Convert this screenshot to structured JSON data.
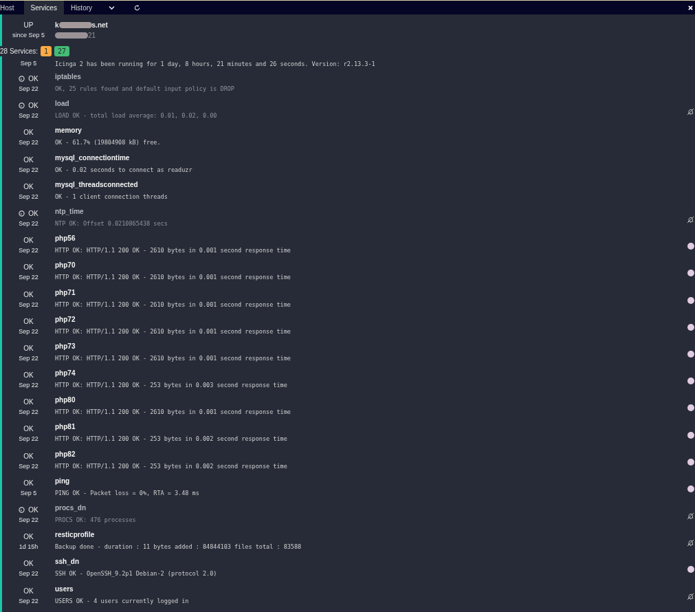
{
  "tabs": [
    {
      "label": "Host",
      "selected": false
    },
    {
      "label": "Services",
      "selected": true
    },
    {
      "label": "History",
      "selected": false
    }
  ],
  "host": {
    "state": "UP",
    "since": "since Sep 5",
    "name_start": "k",
    "name_end": "s.net",
    "address_end": "21"
  },
  "summary": {
    "label": "28 Services:",
    "badges": [
      {
        "count": "1",
        "color": "#ffaa44"
      },
      {
        "count": "27",
        "color": "#44bb77"
      }
    ]
  },
  "host_check": {
    "time": "Sep 5",
    "output": "Icinga 2 has been running for 1 day, 8 hours, 21 minutes and 26 seconds. Version: r2.13.3-1"
  },
  "services": [
    {
      "state": "OK",
      "time": "Sep 22",
      "name": "iptables",
      "output": "OK, 25 rules found and default input policy is DROP",
      "handled": true,
      "notifications_off": false,
      "dot": false
    },
    {
      "state": "OK",
      "time": "Sep 22",
      "name": "load",
      "output": "LOAD OK - total load average: 0.01, 0.02, 0.00",
      "handled": true,
      "notifications_off": true,
      "dot": false
    },
    {
      "state": "OK",
      "time": "Sep 22",
      "name": "memory",
      "output": "OK - 61.7% (19804908 kB) free.",
      "handled": false,
      "notifications_off": false,
      "dot": false
    },
    {
      "state": "OK",
      "time": "Sep 22",
      "name": "mysql_connectiontime",
      "output": "OK - 0.02 seconds to connect as readuzr",
      "handled": false,
      "notifications_off": false,
      "dot": false
    },
    {
      "state": "OK",
      "time": "Sep 22",
      "name": "mysql_threadsconnected",
      "output": "OK - 1 client connection threads",
      "handled": false,
      "notifications_off": false,
      "dot": false
    },
    {
      "state": "OK",
      "time": "Sep 22",
      "name": "ntp_time",
      "output": "NTP OK: Offset 0.0210865438 secs",
      "handled": true,
      "notifications_off": true,
      "dot": false
    },
    {
      "state": "OK",
      "time": "Sep 22",
      "name": "php56",
      "output": "HTTP OK: HTTP/1.1 200 OK - 2610 bytes in 0.001 second response time",
      "handled": false,
      "notifications_off": false,
      "dot": true
    },
    {
      "state": "OK",
      "time": "Sep 22",
      "name": "php70",
      "output": "HTTP OK: HTTP/1.1 200 OK - 2610 bytes in 0.001 second response time",
      "handled": false,
      "notifications_off": false,
      "dot": true
    },
    {
      "state": "OK",
      "time": "Sep 22",
      "name": "php71",
      "output": "HTTP OK: HTTP/1.1 200 OK - 2610 bytes in 0.001 second response time",
      "handled": false,
      "notifications_off": false,
      "dot": true
    },
    {
      "state": "OK",
      "time": "Sep 22",
      "name": "php72",
      "output": "HTTP OK: HTTP/1.1 200 OK - 2610 bytes in 0.001 second response time",
      "handled": false,
      "notifications_off": false,
      "dot": true
    },
    {
      "state": "OK",
      "time": "Sep 22",
      "name": "php73",
      "output": "HTTP OK: HTTP/1.1 200 OK - 2610 bytes in 0.001 second response time",
      "handled": false,
      "notifications_off": false,
      "dot": true
    },
    {
      "state": "OK",
      "time": "Sep 22",
      "name": "php74",
      "output": "HTTP OK: HTTP/1.1 200 OK - 253 bytes in 0.003 second response time",
      "handled": false,
      "notifications_off": false,
      "dot": true
    },
    {
      "state": "OK",
      "time": "Sep 22",
      "name": "php80",
      "output": "HTTP OK: HTTP/1.1 200 OK - 2610 bytes in 0.001 second response time",
      "handled": false,
      "notifications_off": false,
      "dot": true
    },
    {
      "state": "OK",
      "time": "Sep 22",
      "name": "php81",
      "output": "HTTP OK: HTTP/1.1 200 OK - 253 bytes in 0.002 second response time",
      "handled": false,
      "notifications_off": false,
      "dot": true
    },
    {
      "state": "OK",
      "time": "Sep 22",
      "name": "php82",
      "output": "HTTP OK: HTTP/1.1 200 OK - 253 bytes in 0.002 second response time",
      "handled": false,
      "notifications_off": false,
      "dot": true
    },
    {
      "state": "OK",
      "time": "Sep 5",
      "name": "ping",
      "output": "PING OK - Packet loss = 0%, RTA = 3.48 ms",
      "handled": false,
      "notifications_off": false,
      "dot": true
    },
    {
      "state": "OK",
      "time": "Sep 22",
      "name": "procs_dn",
      "output": "PROCS OK: 476 processes",
      "handled": true,
      "notifications_off": true,
      "dot": false
    },
    {
      "state": "OK",
      "time": "1d 15h",
      "name": "resticprofile",
      "output": "Backup done - duration : 11 bytes added : 84844103 files total : 83588",
      "handled": false,
      "notifications_off": true,
      "dot": false
    },
    {
      "state": "OK",
      "time": "Sep 22",
      "name": "ssh_dn",
      "output": "SSH OK - OpenSSH_9.2p1 Debian-2 (protocol 2.0)",
      "handled": false,
      "notifications_off": false,
      "dot": true
    },
    {
      "state": "OK",
      "time": "Sep 22",
      "name": "users",
      "output": "USERS OK - 4 users currently logged in",
      "handled": false,
      "notifications_off": true,
      "dot": false
    }
  ]
}
